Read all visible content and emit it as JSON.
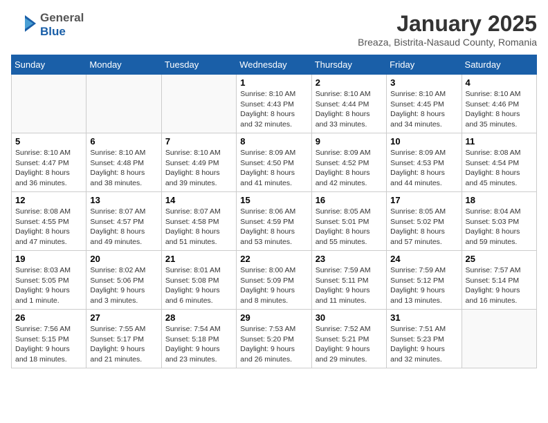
{
  "header": {
    "logo_general": "General",
    "logo_blue": "Blue",
    "title": "January 2025",
    "subtitle": "Breaza, Bistrita-Nasaud County, Romania"
  },
  "weekdays": [
    "Sunday",
    "Monday",
    "Tuesday",
    "Wednesday",
    "Thursday",
    "Friday",
    "Saturday"
  ],
  "weeks": [
    [
      {
        "day": "",
        "info": ""
      },
      {
        "day": "",
        "info": ""
      },
      {
        "day": "",
        "info": ""
      },
      {
        "day": "1",
        "info": "Sunrise: 8:10 AM\nSunset: 4:43 PM\nDaylight: 8 hours and 32 minutes."
      },
      {
        "day": "2",
        "info": "Sunrise: 8:10 AM\nSunset: 4:44 PM\nDaylight: 8 hours and 33 minutes."
      },
      {
        "day": "3",
        "info": "Sunrise: 8:10 AM\nSunset: 4:45 PM\nDaylight: 8 hours and 34 minutes."
      },
      {
        "day": "4",
        "info": "Sunrise: 8:10 AM\nSunset: 4:46 PM\nDaylight: 8 hours and 35 minutes."
      }
    ],
    [
      {
        "day": "5",
        "info": "Sunrise: 8:10 AM\nSunset: 4:47 PM\nDaylight: 8 hours and 36 minutes."
      },
      {
        "day": "6",
        "info": "Sunrise: 8:10 AM\nSunset: 4:48 PM\nDaylight: 8 hours and 38 minutes."
      },
      {
        "day": "7",
        "info": "Sunrise: 8:10 AM\nSunset: 4:49 PM\nDaylight: 8 hours and 39 minutes."
      },
      {
        "day": "8",
        "info": "Sunrise: 8:09 AM\nSunset: 4:50 PM\nDaylight: 8 hours and 41 minutes."
      },
      {
        "day": "9",
        "info": "Sunrise: 8:09 AM\nSunset: 4:52 PM\nDaylight: 8 hours and 42 minutes."
      },
      {
        "day": "10",
        "info": "Sunrise: 8:09 AM\nSunset: 4:53 PM\nDaylight: 8 hours and 44 minutes."
      },
      {
        "day": "11",
        "info": "Sunrise: 8:08 AM\nSunset: 4:54 PM\nDaylight: 8 hours and 45 minutes."
      }
    ],
    [
      {
        "day": "12",
        "info": "Sunrise: 8:08 AM\nSunset: 4:55 PM\nDaylight: 8 hours and 47 minutes."
      },
      {
        "day": "13",
        "info": "Sunrise: 8:07 AM\nSunset: 4:57 PM\nDaylight: 8 hours and 49 minutes."
      },
      {
        "day": "14",
        "info": "Sunrise: 8:07 AM\nSunset: 4:58 PM\nDaylight: 8 hours and 51 minutes."
      },
      {
        "day": "15",
        "info": "Sunrise: 8:06 AM\nSunset: 4:59 PM\nDaylight: 8 hours and 53 minutes."
      },
      {
        "day": "16",
        "info": "Sunrise: 8:05 AM\nSunset: 5:01 PM\nDaylight: 8 hours and 55 minutes."
      },
      {
        "day": "17",
        "info": "Sunrise: 8:05 AM\nSunset: 5:02 PM\nDaylight: 8 hours and 57 minutes."
      },
      {
        "day": "18",
        "info": "Sunrise: 8:04 AM\nSunset: 5:03 PM\nDaylight: 8 hours and 59 minutes."
      }
    ],
    [
      {
        "day": "19",
        "info": "Sunrise: 8:03 AM\nSunset: 5:05 PM\nDaylight: 9 hours and 1 minute."
      },
      {
        "day": "20",
        "info": "Sunrise: 8:02 AM\nSunset: 5:06 PM\nDaylight: 9 hours and 3 minutes."
      },
      {
        "day": "21",
        "info": "Sunrise: 8:01 AM\nSunset: 5:08 PM\nDaylight: 9 hours and 6 minutes."
      },
      {
        "day": "22",
        "info": "Sunrise: 8:00 AM\nSunset: 5:09 PM\nDaylight: 9 hours and 8 minutes."
      },
      {
        "day": "23",
        "info": "Sunrise: 7:59 AM\nSunset: 5:11 PM\nDaylight: 9 hours and 11 minutes."
      },
      {
        "day": "24",
        "info": "Sunrise: 7:59 AM\nSunset: 5:12 PM\nDaylight: 9 hours and 13 minutes."
      },
      {
        "day": "25",
        "info": "Sunrise: 7:57 AM\nSunset: 5:14 PM\nDaylight: 9 hours and 16 minutes."
      }
    ],
    [
      {
        "day": "26",
        "info": "Sunrise: 7:56 AM\nSunset: 5:15 PM\nDaylight: 9 hours and 18 minutes."
      },
      {
        "day": "27",
        "info": "Sunrise: 7:55 AM\nSunset: 5:17 PM\nDaylight: 9 hours and 21 minutes."
      },
      {
        "day": "28",
        "info": "Sunrise: 7:54 AM\nSunset: 5:18 PM\nDaylight: 9 hours and 23 minutes."
      },
      {
        "day": "29",
        "info": "Sunrise: 7:53 AM\nSunset: 5:20 PM\nDaylight: 9 hours and 26 minutes."
      },
      {
        "day": "30",
        "info": "Sunrise: 7:52 AM\nSunset: 5:21 PM\nDaylight: 9 hours and 29 minutes."
      },
      {
        "day": "31",
        "info": "Sunrise: 7:51 AM\nSunset: 5:23 PM\nDaylight: 9 hours and 32 minutes."
      },
      {
        "day": "",
        "info": ""
      }
    ]
  ]
}
